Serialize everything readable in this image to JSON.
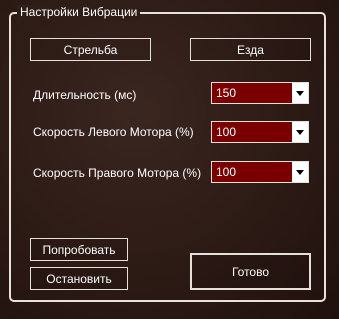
{
  "panel": {
    "title": "Настройки Вибрации"
  },
  "tabs": {
    "shooting_label": "Стрельба",
    "driving_label": "Езда"
  },
  "settings": [
    {
      "label": "Длительность (мс)",
      "value": "150"
    },
    {
      "label": "Скорость Левого Мотора (%)",
      "value": "100"
    },
    {
      "label": "Скорость Правого Мотора (%)",
      "value": "100"
    }
  ],
  "actions": {
    "try_label": "Попробовать",
    "stop_label": "Остановить",
    "done_label": "Готово"
  },
  "colors": {
    "select_bg": "#7a0000",
    "border": "#e6e0da",
    "background": "#2e1c17"
  },
  "icons": {
    "dropdown": "chevron-down-icon"
  }
}
